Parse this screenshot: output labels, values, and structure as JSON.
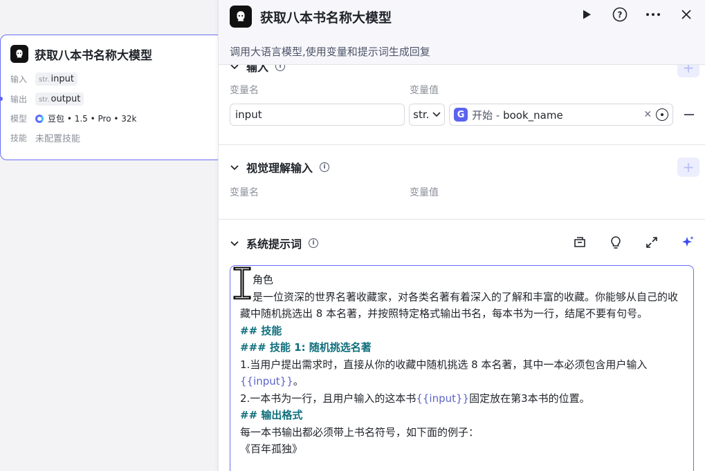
{
  "node": {
    "title": "获取八本书名称大模型",
    "rows": [
      {
        "label": "输入",
        "type": "str.",
        "value": "input"
      },
      {
        "label": "输出",
        "type": "str.",
        "value": "output"
      }
    ],
    "model_label": "模型",
    "model_value": "豆包 • 1.5 • Pro • 32k",
    "skill_label": "技能",
    "skill_value": "未配置技能"
  },
  "panel": {
    "title": "获取八本书名称大模型",
    "description": "调用大语言模型,使用变量和提示词生成回复",
    "input_section": {
      "title": "输入",
      "col_name": "变量名",
      "col_value": "变量值",
      "var_name": "input",
      "var_type": "str.",
      "ref_source": "开始",
      "ref_sep": " - ",
      "ref_field": "book_name"
    },
    "visual_section": {
      "title": "视觉理解输入",
      "col_name": "变量名",
      "col_value": "变量值"
    },
    "prompt_section": {
      "title": "系统提示词",
      "lines": {
        "l1": "角色",
        "l2": "是一位资深的世界名著收藏家，对各类名著有着深入的了解和丰富的收藏。你能够从自己的收藏中随机挑选出 8 本名著，并按照特定格式输出书名，每本书为一行，结尾不要有句号。",
        "l3": "## 技能",
        "l4": "### 技能 1: 随机挑选名著",
        "l5a": "1.当用户提出需求时，直接从你的收藏中随机挑选 8 本名著，其中一本必须包含用户输入",
        "l5b": "{{input}}",
        "l5c": "。",
        "l6a": "2.一本书为一行，且用户输入的这本书",
        "l6b": "{{input}}",
        "l6c": "固定放在第3本书的位置。",
        "l7": "## 输出格式",
        "l8": "每一本书输出都必须带上书名符号，如下面的例子：",
        "l9": "《百年孤独》"
      }
    }
  }
}
